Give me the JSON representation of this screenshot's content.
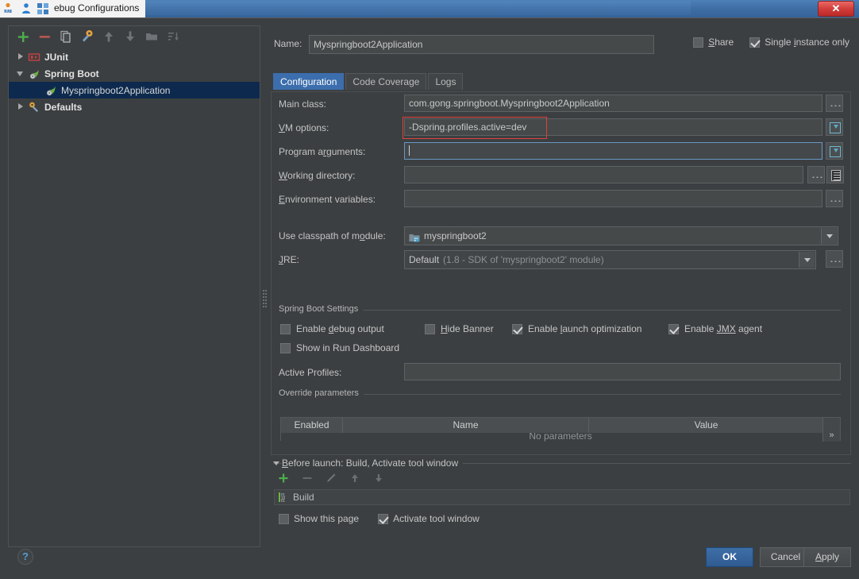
{
  "window": {
    "title": "ebug Configurations",
    "close_label": "✕",
    "icons": [
      "app-3d-icon",
      "person-icon",
      "grid-icon"
    ]
  },
  "sidebar": {
    "toolbar": [
      {
        "name": "add-configuration-button",
        "glyph": "+"
      },
      {
        "name": "remove-configuration-button",
        "glyph": "−"
      },
      {
        "name": "copy-configuration-button",
        "glyph": "copy"
      },
      {
        "name": "edit-defaults-button",
        "glyph": "wrench"
      },
      {
        "name": "move-up-button",
        "glyph": "arrow-up"
      },
      {
        "name": "move-down-button",
        "glyph": "arrow-down"
      },
      {
        "name": "new-folder-button",
        "glyph": "folder"
      },
      {
        "name": "sort-configurations-button",
        "glyph": "sort"
      }
    ],
    "tree": [
      {
        "label": "JUnit",
        "level": 0,
        "expanded": false,
        "icon": "junit-icon",
        "selected": false
      },
      {
        "label": "Spring Boot",
        "level": 0,
        "expanded": true,
        "icon": "spring-icon",
        "selected": false
      },
      {
        "label": "Myspringboot2Application",
        "level": 1,
        "expanded": null,
        "icon": "spring-icon",
        "selected": true
      },
      {
        "label": "Defaults",
        "level": 0,
        "expanded": false,
        "icon": "wrench-icon",
        "selected": false
      }
    ]
  },
  "header": {
    "name_label": "Name:",
    "name_value": "Myspringboot2Application",
    "share_label": "Share",
    "share_checked": false,
    "single_instance_label": "Single instance only",
    "single_instance_checked": true
  },
  "tabs": [
    {
      "label": "Configuration",
      "active": true
    },
    {
      "label": "Code Coverage",
      "active": false
    },
    {
      "label": "Logs",
      "active": false
    }
  ],
  "configuration": {
    "main_class_label": "Main class:",
    "main_class_value": "com.gong.springboot.Myspringboot2Application",
    "vm_options_label": "VM options:",
    "vm_options_value": "-Dspring.profiles.active=dev",
    "program_arguments_label": "Program arguments:",
    "program_arguments_value": "",
    "working_directory_label": "Working directory:",
    "working_directory_value": "",
    "environment_variables_label": "Environment variables:",
    "environment_variables_value": "",
    "use_classpath_label": "Use classpath of module:",
    "use_classpath_value": "myspringboot2",
    "jre_label": "JRE:",
    "jre_value": "Default",
    "jre_value_detail": "(1.8 - SDK of 'myspringboot2' module)"
  },
  "spring_boot_settings": {
    "group_title": "Spring Boot Settings",
    "checkboxes": [
      {
        "label": "Enable debug output",
        "checked": false
      },
      {
        "label": "Hide Banner",
        "checked": false
      },
      {
        "label": "Enable launch optimization",
        "checked": true
      },
      {
        "label": "Enable JMX agent",
        "checked": true
      },
      {
        "label": "Show in Run Dashboard",
        "checked": false
      }
    ],
    "active_profiles_label": "Active Profiles:",
    "active_profiles_value": ""
  },
  "override_parameters": {
    "group_title": "Override parameters",
    "columns": [
      "Enabled",
      "Name",
      "Value"
    ],
    "empty_text": "No parameters",
    "more_glyph": "»"
  },
  "before_launch": {
    "title": "Before launch: Build, Activate tool window",
    "toolbar": [
      {
        "name": "add-task-button",
        "glyph": "+"
      },
      {
        "name": "remove-task-button",
        "glyph": "−"
      },
      {
        "name": "edit-task-button",
        "glyph": "pencil"
      },
      {
        "name": "move-task-up-button",
        "glyph": "arrow-up"
      },
      {
        "name": "move-task-down-button",
        "glyph": "arrow-down"
      }
    ],
    "tasks": [
      {
        "label": "Build",
        "icon": "build-icon"
      }
    ],
    "show_this_page_label": "Show this page",
    "show_this_page_checked": false,
    "activate_tool_window_label": "Activate tool window",
    "activate_tool_window_checked": true
  },
  "footer": {
    "help_label": "?",
    "ok_label": "OK",
    "cancel_label": "Cancel",
    "apply_label": "Apply"
  },
  "colors": {
    "accent_blue": "#3c6ead",
    "highlight_red": "#e2403c",
    "selection_blue": "#0d2a4e",
    "background": "#3c3f41"
  }
}
